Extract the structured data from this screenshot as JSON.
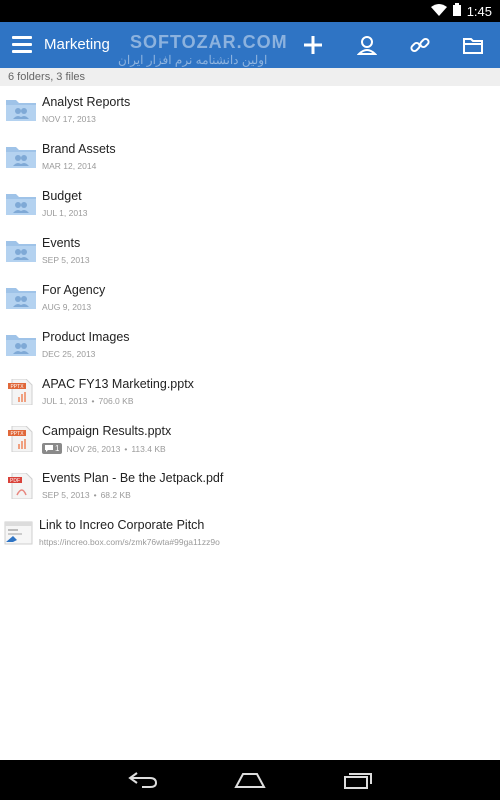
{
  "status_bar": {
    "time": "1:45"
  },
  "app_bar": {
    "title": "Marketing",
    "watermark": "SOFTOZAR.COM",
    "watermark_sub": "اولین دانشنامه نرم افزار ایران",
    "actions": [
      "plus-icon",
      "user-icon",
      "link-icon",
      "folder-icon"
    ]
  },
  "summary": "6 folders, 3 files",
  "folders": [
    {
      "name": "Analyst Reports",
      "date": "NOV 17, 2013"
    },
    {
      "name": "Brand Assets",
      "date": "MAR 12, 2014"
    },
    {
      "name": "Budget",
      "date": "JUL 1, 2013"
    },
    {
      "name": "Events",
      "date": "SEP 5, 2013"
    },
    {
      "name": "For Agency",
      "date": "AUG 9, 2013"
    },
    {
      "name": "Product Images",
      "date": "DEC 25, 2013"
    }
  ],
  "files": [
    {
      "name": "APAC FY13 Marketing.pptx",
      "date": "JUL 1, 2013",
      "size": "706.0 KB",
      "type_label": "PPTX",
      "color": "#e0683a"
    },
    {
      "name": "Campaign Results.pptx",
      "date": "NOV 26, 2013",
      "size": "113.4 KB",
      "type_label": "PPTX",
      "color": "#e0683a",
      "comments": "1"
    },
    {
      "name": "Events Plan - Be the Jetpack.pdf",
      "date": "SEP 5, 2013",
      "size": "68.2 KB",
      "type_label": "PDF",
      "color": "#d9423a"
    }
  ],
  "bookmark": {
    "name": "Link to Increo Corporate Pitch",
    "url": "https://increo.box.com/s/zmk76wta#99ga11zz9o"
  },
  "separator": "•",
  "colors": {
    "app_bar": "#2f74c4",
    "folder": "#9fc3e8"
  }
}
